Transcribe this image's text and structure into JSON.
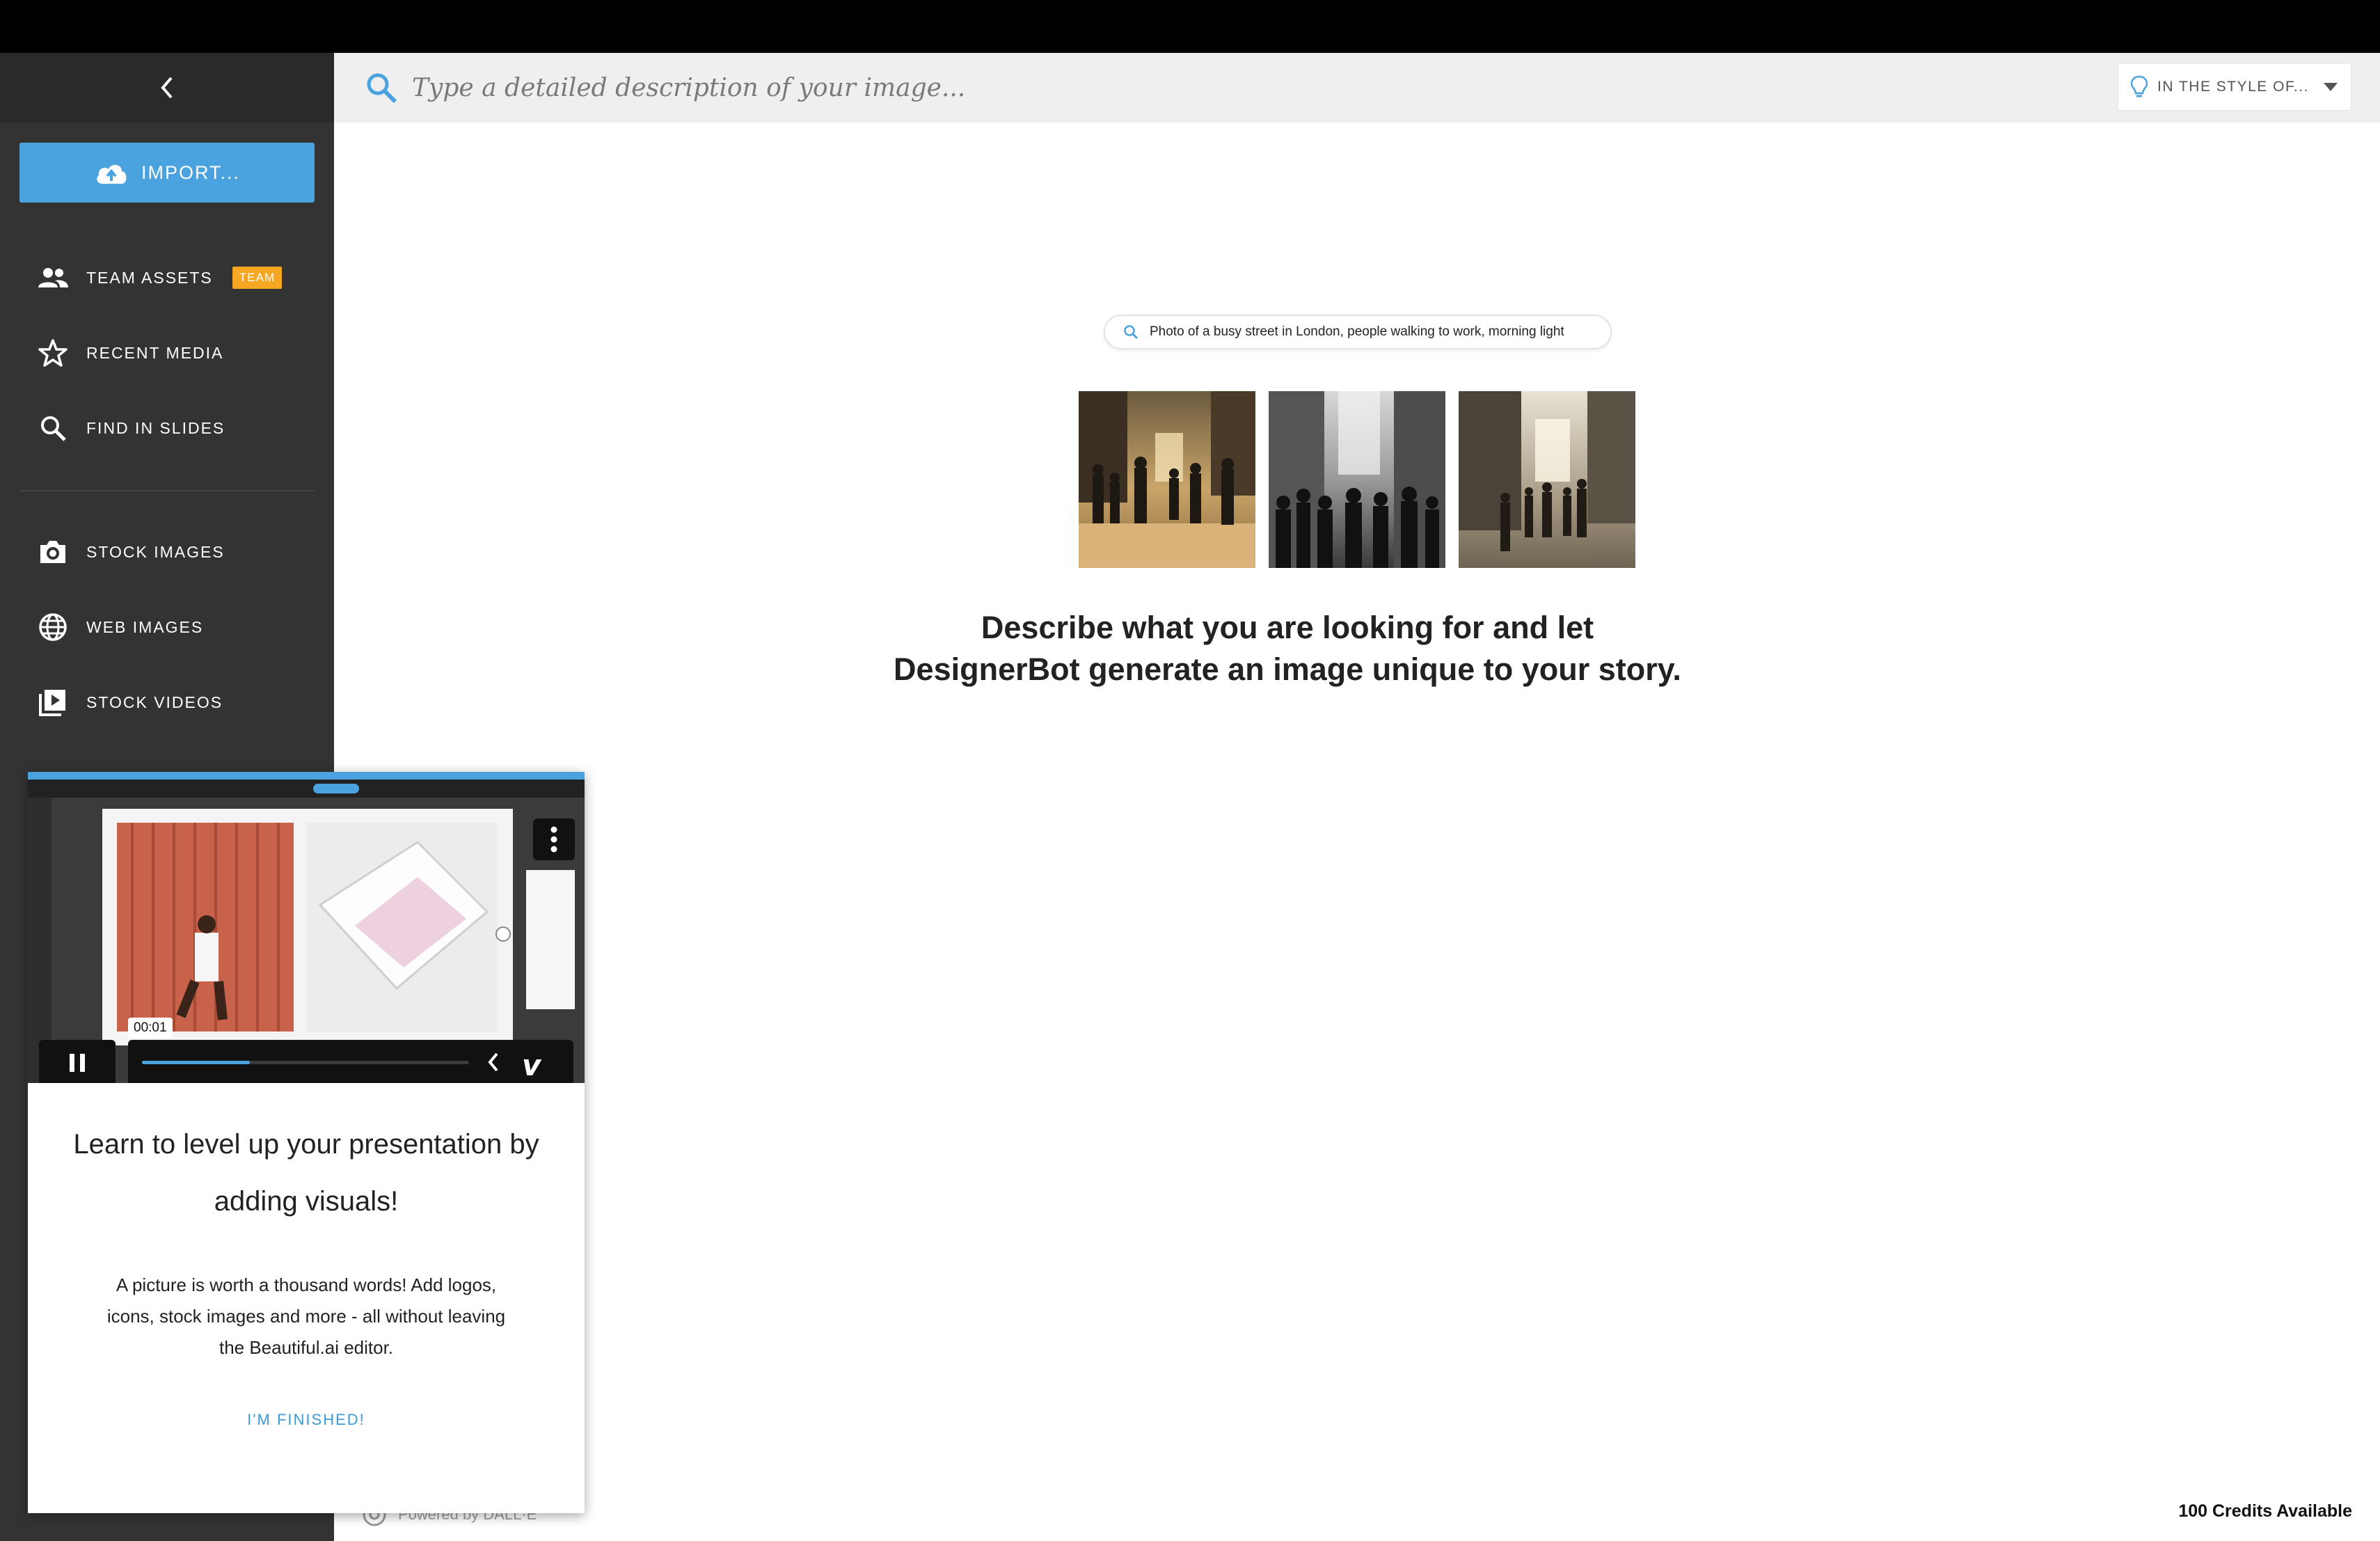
{
  "sidebar": {
    "collapse_icon": "chevron-left-icon",
    "import_label": "IMPORT...",
    "items": [
      {
        "label": "TEAM ASSETS",
        "icon": "people-icon",
        "badge": "TEAM"
      },
      {
        "label": "RECENT MEDIA",
        "icon": "star-icon"
      },
      {
        "label": "FIND IN SLIDES",
        "icon": "search-icon"
      },
      {
        "label": "STOCK IMAGES",
        "icon": "camera-icon"
      },
      {
        "label": "WEB IMAGES",
        "icon": "globe-icon"
      },
      {
        "label": "STOCK VIDEOS",
        "icon": "video-icon"
      }
    ]
  },
  "search": {
    "placeholder": "Type a detailed description of your image...",
    "style_label": "IN THE STYLE OF..."
  },
  "example": {
    "prompt": "Photo of a busy street in London, people walking to work, morning light",
    "headline": "Describe what you are looking for and let DesignerBot generate an image unique to your story."
  },
  "footer": {
    "powered_by": "Powered by DALL·E",
    "credits": "100 Credits Available"
  },
  "popup": {
    "video_time": "00:01",
    "video_progress": 0.33,
    "title": "Learn to level up your presentation by adding visuals!",
    "body": "A picture is worth a thousand words! Add logos, icons, stock images and more - all without leaving the Beautiful.ai editor.",
    "finish_label": "I'M FINISHED!"
  },
  "colors": {
    "accent": "#4aa3df",
    "sidebar": "#333333",
    "badge": "#f5a623"
  }
}
